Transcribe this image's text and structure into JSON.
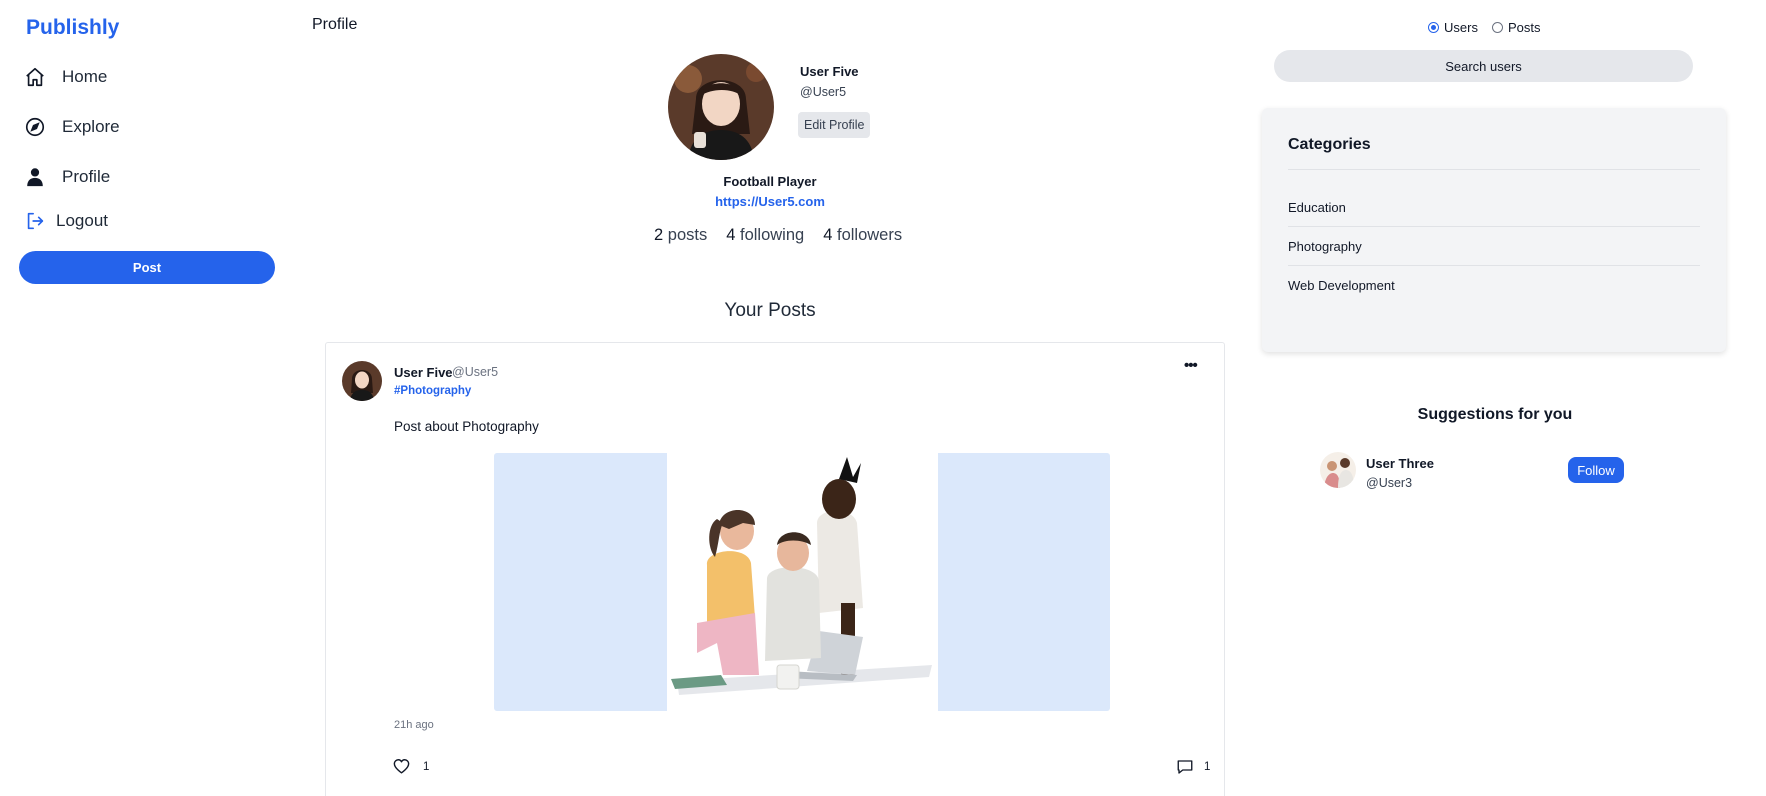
{
  "sidebar": {
    "brand": "Publishly",
    "items": [
      {
        "label": "Home",
        "icon": "home-icon"
      },
      {
        "label": "Explore",
        "icon": "compass-icon"
      },
      {
        "label": "Profile",
        "icon": "user-icon"
      },
      {
        "label": "Logout",
        "icon": "logout-icon"
      }
    ],
    "post_button": "Post"
  },
  "main": {
    "page_title": "Profile",
    "profile": {
      "name": "User Five",
      "handle": "@User5",
      "edit_button": "Edit Profile",
      "bio": "Football Player",
      "website": "https://User5.com",
      "stats": {
        "posts_count": "2",
        "posts_label": "posts",
        "following_count": "4",
        "following_label": "following",
        "followers_count": "4",
        "followers_label": "followers"
      }
    },
    "posts_title": "Your Posts",
    "posts": [
      {
        "author": "User Five",
        "handle": "@User5",
        "tag": "#Photography",
        "text": "Post about Photography",
        "time": "21h ago",
        "likes": "1",
        "comments": "1"
      }
    ]
  },
  "right": {
    "search_mode": {
      "options": [
        "Users",
        "Posts"
      ],
      "selected": "Users"
    },
    "search_placeholder": "Search users",
    "categories": {
      "title": "Categories",
      "items": [
        "Education",
        "Photography",
        "Web Development"
      ]
    },
    "suggestions": {
      "title": "Suggestions for you",
      "users": [
        {
          "name": "User Three",
          "handle": "@User3",
          "button": "Follow"
        }
      ]
    }
  },
  "colors": {
    "accent": "#2563eb",
    "panel": "#f3f4f6",
    "media_bg": "#dbe8fb"
  }
}
